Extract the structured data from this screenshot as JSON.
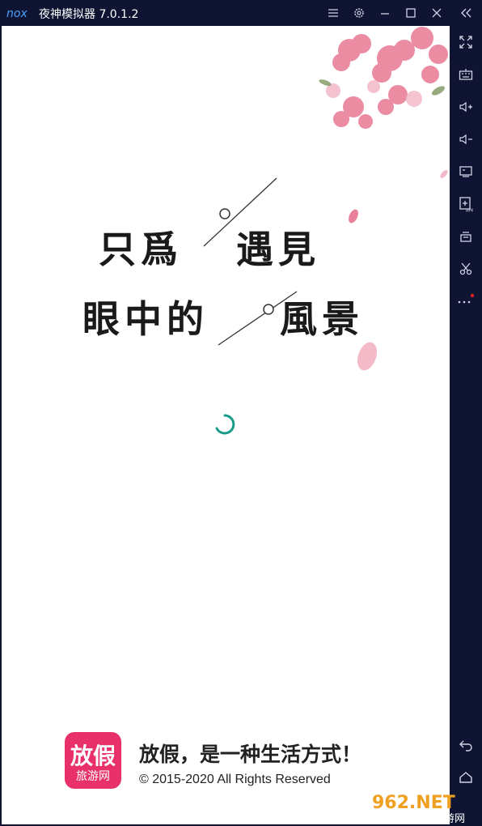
{
  "window": {
    "app_title": "夜神模拟器 7.0.1.2",
    "logo_text": "nox"
  },
  "titlebar_icons": [
    "menu-icon",
    "settings-icon",
    "minimize-icon",
    "maximize-icon",
    "close-icon",
    "collapse-sidebar-icon"
  ],
  "sidebar_icons": [
    "fullscreen-icon",
    "keyboard-icon",
    "volume-up-icon",
    "volume-down-icon",
    "screen-icon",
    "install-apk-icon",
    "multi-instance-icon",
    "scissors-icon",
    "more-icon",
    "back-icon",
    "home-icon"
  ],
  "splash": {
    "poem_line1_a": "只爲",
    "poem_line1_b": "遇見",
    "poem_line2_a": "眼中的",
    "poem_line2_b": "風景"
  },
  "footer": {
    "logo_main": "放假",
    "logo_sub": "旅游网",
    "slogan": "放假，是一种生活方式！",
    "copyright": "© 2015-2020  All Rights Reserved"
  },
  "watermark": {
    "main": "962.NET",
    "sub": "乐游网"
  },
  "colors": {
    "frame": "#0f1433",
    "spinner": "#1a9a8a",
    "logo_bg": "#e8306a",
    "petal": "#e9809a"
  }
}
